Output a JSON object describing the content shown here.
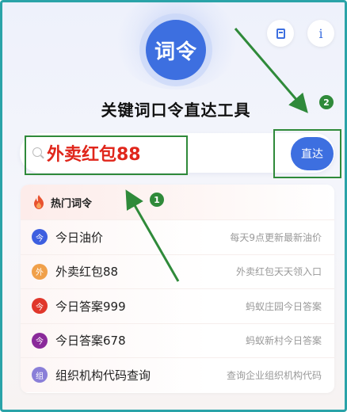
{
  "app": {
    "logo_text": "词令",
    "title": "关键词口令直达工具"
  },
  "top_buttons": {
    "bookmark_icon": "bookmark-icon",
    "info_label": "i"
  },
  "search": {
    "value": "外卖红包88",
    "go_label": "直达"
  },
  "hot": {
    "header_label": "热门词令",
    "items": [
      {
        "badge": "今",
        "badge_color": "#3d5fe0",
        "title": "今日油价",
        "desc": "每天9点更新最新油价"
      },
      {
        "badge": "外",
        "badge_color": "#f0a04a",
        "title": "外卖红包88",
        "desc": "外卖红包天天领入口"
      },
      {
        "badge": "今",
        "badge_color": "#e0372b",
        "title": "今日答案999",
        "desc": "蚂蚁庄园今日答案"
      },
      {
        "badge": "今",
        "badge_color": "#8a2a9a",
        "title": "今日答案678",
        "desc": "蚂蚁新村今日答案"
      },
      {
        "badge": "组",
        "badge_color": "#8a7fd8",
        "title": "组织机构代码查询",
        "desc": "查询企业组织机构代码"
      }
    ]
  },
  "annotations": {
    "marker_1": "1",
    "marker_2": "2"
  },
  "colors": {
    "accent": "#3d6fe0",
    "highlight_text": "#e0261b",
    "annotation_green": "#2f8a3a",
    "frame": "#2aa3a8"
  }
}
